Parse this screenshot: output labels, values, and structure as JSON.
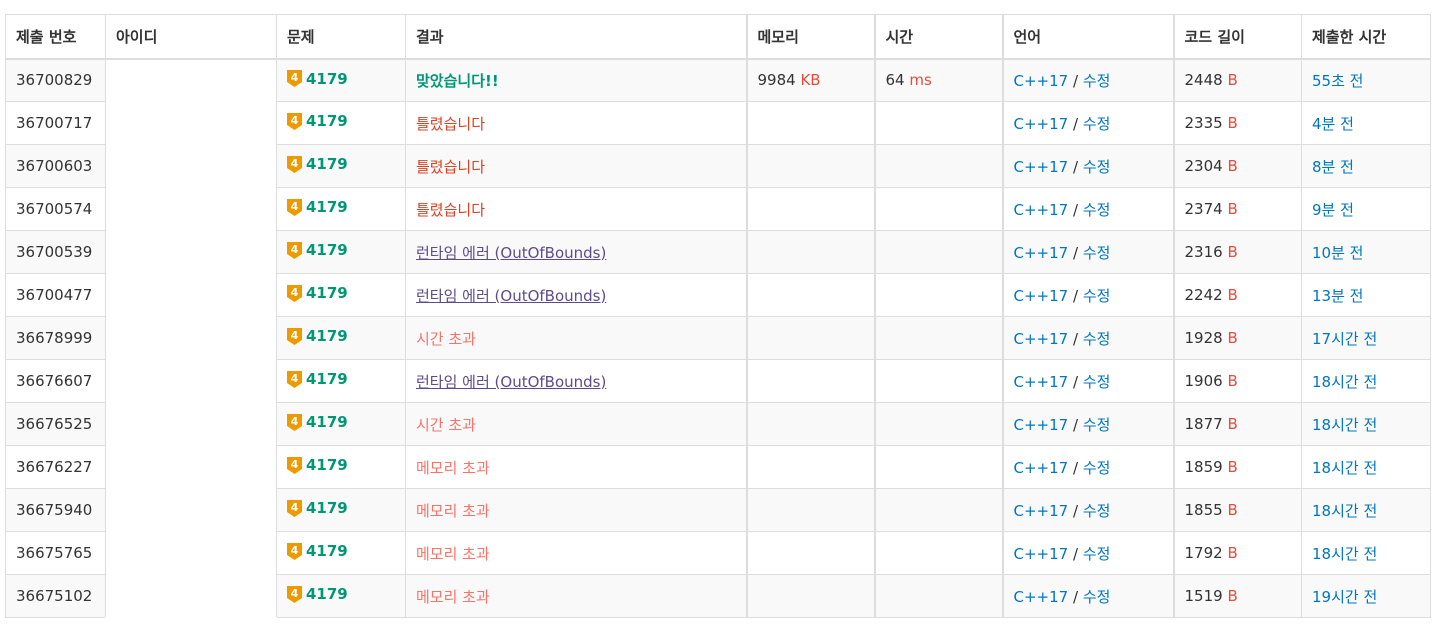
{
  "headers": {
    "submission_id": "제출 번호",
    "user_id": "아이디",
    "problem": "문제",
    "result": "결과",
    "memory": "메모리",
    "time": "시간",
    "language": "언어",
    "code_length": "코드 길이",
    "submitted_at": "제출한 시간"
  },
  "colors": {
    "accepted": "#009874",
    "wrong": "#dd4124",
    "limit": "#fa7268",
    "runtime": "#5f4b8b",
    "link": "#0076c0",
    "unit": "#e74c3c",
    "tier_gold": "#ec9a00"
  },
  "edit_label": "수정",
  "lang_sep": "/",
  "rows": [
    {
      "id": "36700829",
      "tier": "4",
      "problem": "4179",
      "result": "맞았습니다!!",
      "result_type": "ac",
      "memory": "9984",
      "memory_unit": "KB",
      "time": "64",
      "time_unit": "ms",
      "lang": "C++17",
      "length": "2448",
      "length_unit": "B",
      "ago": "55초 전"
    },
    {
      "id": "36700717",
      "tier": "4",
      "problem": "4179",
      "result": "틀렸습니다",
      "result_type": "wa",
      "memory": "",
      "memory_unit": "",
      "time": "",
      "time_unit": "",
      "lang": "C++17",
      "length": "2335",
      "length_unit": "B",
      "ago": "4분 전"
    },
    {
      "id": "36700603",
      "tier": "4",
      "problem": "4179",
      "result": "틀렸습니다",
      "result_type": "wa",
      "memory": "",
      "memory_unit": "",
      "time": "",
      "time_unit": "",
      "lang": "C++17",
      "length": "2304",
      "length_unit": "B",
      "ago": "8분 전"
    },
    {
      "id": "36700574",
      "tier": "4",
      "problem": "4179",
      "result": "틀렸습니다",
      "result_type": "wa",
      "memory": "",
      "memory_unit": "",
      "time": "",
      "time_unit": "",
      "lang": "C++17",
      "length": "2374",
      "length_unit": "B",
      "ago": "9분 전"
    },
    {
      "id": "36700539",
      "tier": "4",
      "problem": "4179",
      "result": "런타임 에러 (OutOfBounds)",
      "result_type": "rte",
      "memory": "",
      "memory_unit": "",
      "time": "",
      "time_unit": "",
      "lang": "C++17",
      "length": "2316",
      "length_unit": "B",
      "ago": "10분 전"
    },
    {
      "id": "36700477",
      "tier": "4",
      "problem": "4179",
      "result": "런타임 에러 (OutOfBounds)",
      "result_type": "rte",
      "memory": "",
      "memory_unit": "",
      "time": "",
      "time_unit": "",
      "lang": "C++17",
      "length": "2242",
      "length_unit": "B",
      "ago": "13분 전"
    },
    {
      "id": "36678999",
      "tier": "4",
      "problem": "4179",
      "result": "시간 초과",
      "result_type": "tle",
      "memory": "",
      "memory_unit": "",
      "time": "",
      "time_unit": "",
      "lang": "C++17",
      "length": "1928",
      "length_unit": "B",
      "ago": "17시간 전"
    },
    {
      "id": "36676607",
      "tier": "4",
      "problem": "4179",
      "result": "런타임 에러 (OutOfBounds)",
      "result_type": "rte",
      "memory": "",
      "memory_unit": "",
      "time": "",
      "time_unit": "",
      "lang": "C++17",
      "length": "1906",
      "length_unit": "B",
      "ago": "18시간 전"
    },
    {
      "id": "36676525",
      "tier": "4",
      "problem": "4179",
      "result": "시간 초과",
      "result_type": "tle",
      "memory": "",
      "memory_unit": "",
      "time": "",
      "time_unit": "",
      "lang": "C++17",
      "length": "1877",
      "length_unit": "B",
      "ago": "18시간 전"
    },
    {
      "id": "36676227",
      "tier": "4",
      "problem": "4179",
      "result": "메모리 초과",
      "result_type": "mle",
      "memory": "",
      "memory_unit": "",
      "time": "",
      "time_unit": "",
      "lang": "C++17",
      "length": "1859",
      "length_unit": "B",
      "ago": "18시간 전"
    },
    {
      "id": "36675940",
      "tier": "4",
      "problem": "4179",
      "result": "메모리 초과",
      "result_type": "mle",
      "memory": "",
      "memory_unit": "",
      "time": "",
      "time_unit": "",
      "lang": "C++17",
      "length": "1855",
      "length_unit": "B",
      "ago": "18시간 전"
    },
    {
      "id": "36675765",
      "tier": "4",
      "problem": "4179",
      "result": "메모리 초과",
      "result_type": "mle",
      "memory": "",
      "memory_unit": "",
      "time": "",
      "time_unit": "",
      "lang": "C++17",
      "length": "1792",
      "length_unit": "B",
      "ago": "18시간 전"
    },
    {
      "id": "36675102",
      "tier": "4",
      "problem": "4179",
      "result": "메모리 초과",
      "result_type": "mle",
      "memory": "",
      "memory_unit": "",
      "time": "",
      "time_unit": "",
      "lang": "C++17",
      "length": "1519",
      "length_unit": "B",
      "ago": "19시간 전"
    }
  ]
}
